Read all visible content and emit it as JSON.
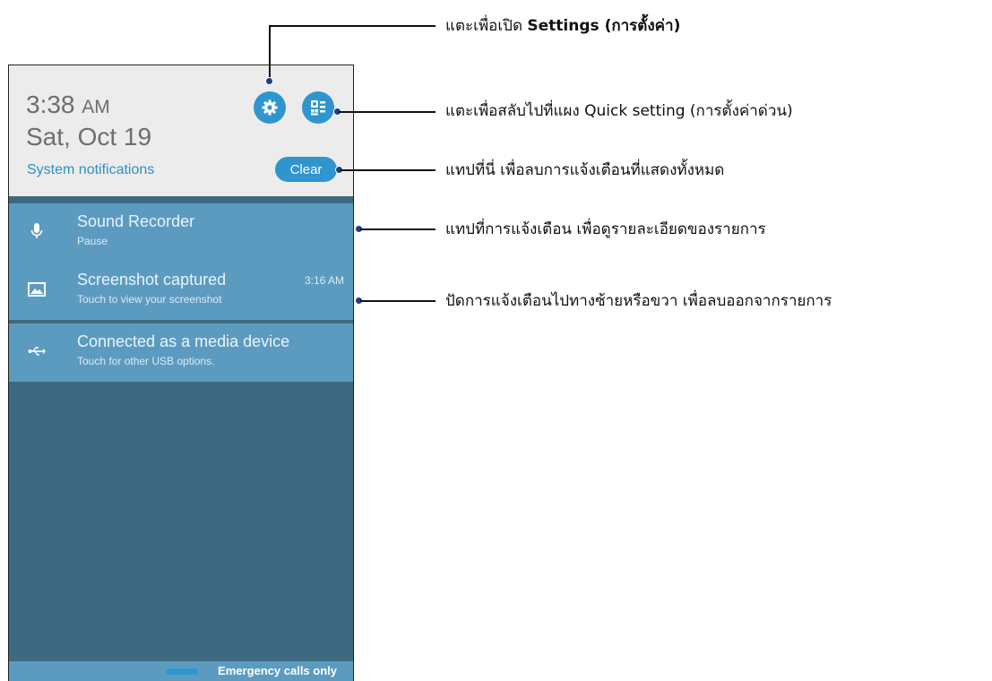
{
  "shade": {
    "time": "3:38",
    "ampm": "AM",
    "date": "Sat, Oct 19",
    "system_notifications": "System notifications",
    "clear_label": "Clear"
  },
  "notifications": [
    {
      "title": "Sound Recorder",
      "subtitle": "Pause",
      "time": "",
      "icon": "microphone-icon"
    },
    {
      "title": "Screenshot captured",
      "subtitle": "Touch to view your screenshot",
      "time": "3:16 AM",
      "icon": "image-icon"
    },
    {
      "title": "Connected as a media device",
      "subtitle": "Touch for other USB options.",
      "time": "",
      "icon": "usb-icon"
    }
  ],
  "status_bar": {
    "text": "Emergency calls only"
  },
  "callouts": {
    "settings_prefix": "แตะเพื่อเปิด ",
    "settings_bold": "Settings (การตั้งค่า)",
    "quick": "แตะเพื่อสลับไปที่แผง Quick setting (การตั้งค่าด่วน)",
    "clear": "แทปที่นี่ เพื่อลบการแจ้งเตือนที่แสดงทั้งหมด",
    "tap_notification": "แทปที่การแจ้งเตือน เพื่อดูรายละเอียดของรายการ",
    "swipe": "ปัดการแจ้งเตือนไปทางซ้ายหรือขวา เพื่อลบออกจากรายการ"
  },
  "colors": {
    "accent": "#2f95cf",
    "notification_bg": "#5c9bc0",
    "panel_bg": "#3d6a80",
    "header_bg": "#ececec"
  }
}
